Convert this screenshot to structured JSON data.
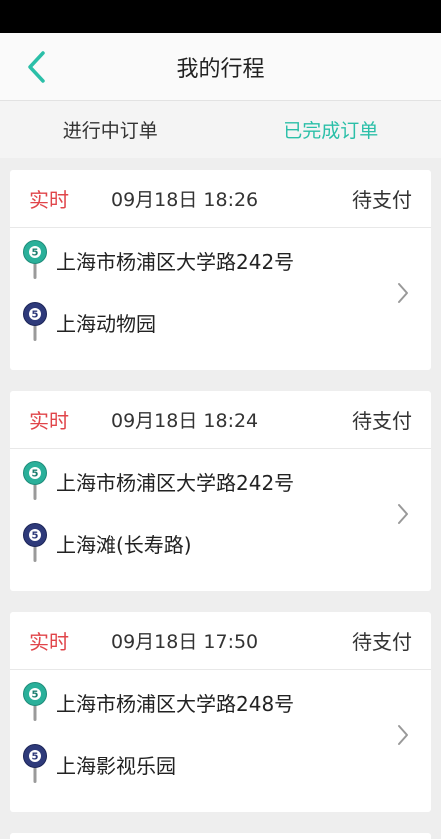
{
  "header": {
    "title": "我的行程"
  },
  "tabs": [
    {
      "label": "进行中订单",
      "active": false
    },
    {
      "label": "已完成订单",
      "active": true
    }
  ],
  "orders": [
    {
      "type": "实时",
      "time": "09月18日 18:26",
      "status": "待支付",
      "from": "上海市杨浦区大学路242号",
      "to": "上海动物园",
      "pin_digit": "5"
    },
    {
      "type": "实时",
      "time": "09月18日 18:24",
      "status": "待支付",
      "from": "上海市杨浦区大学路242号",
      "to": "上海滩(长寿路)",
      "pin_digit": "5"
    },
    {
      "type": "实时",
      "time": "09月18日 17:50",
      "status": "待支付",
      "from": "上海市杨浦区大学路248号",
      "to": "上海影视乐园",
      "pin_digit": "5"
    }
  ],
  "colors": {
    "accent": "#2bbfa8",
    "realtime": "#e0454a",
    "pin_start": "#2ab09a",
    "pin_end": "#2e3a7a"
  },
  "icons": {
    "back": "chevron-left-icon",
    "start_pin": "start-pin-icon",
    "end_pin": "end-pin-icon",
    "detail": "chevron-right-icon"
  }
}
